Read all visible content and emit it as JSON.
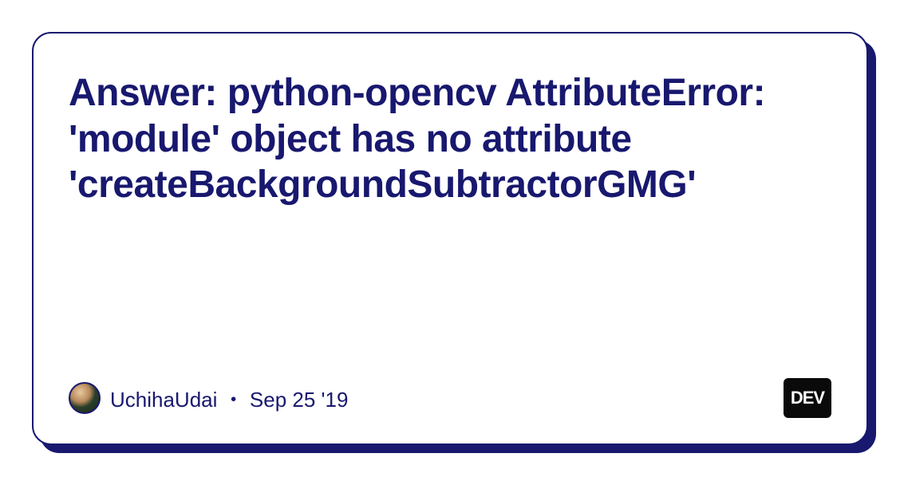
{
  "card": {
    "title": "Answer: python-opencv AttributeError: 'module' object has no attribute 'createBackgroundSubtractorGMG'",
    "author": "UchihaUdai",
    "separator": "・",
    "date": "Sep 25 '19"
  },
  "badge": {
    "label": "DEV"
  }
}
